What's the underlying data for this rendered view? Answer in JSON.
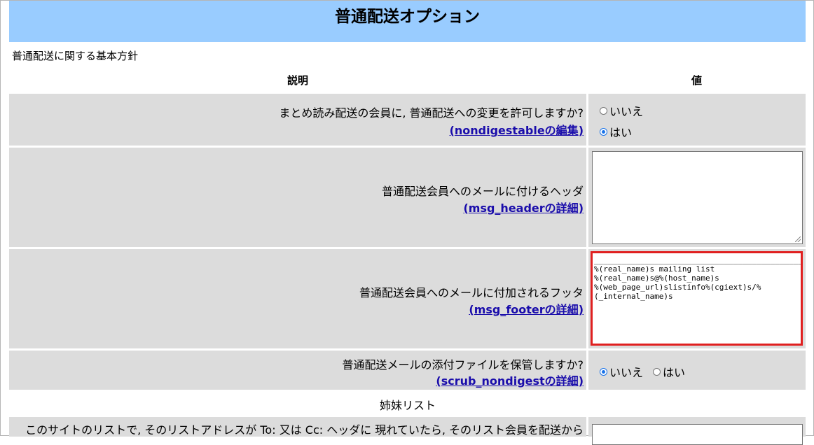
{
  "page": {
    "title": "普通配送オプション",
    "policy_label": "普通配送に関する基本方針"
  },
  "table": {
    "col_desc": "説明",
    "col_value": "値"
  },
  "rows": [
    {
      "question": "まとめ読み配送の会員に, 普通配送への変更を許可しますか?",
      "link_name": "nondigestable",
      "link_suffix": "の編集",
      "options": [
        "いいえ",
        "はい"
      ],
      "selected": "はい"
    },
    {
      "question": "普通配送会員へのメールに付けるヘッダ",
      "link_name": "msg_header",
      "link_suffix": "の詳細",
      "value": ""
    },
    {
      "question": "普通配送会員へのメールに付加されるフッタ",
      "link_name": "msg_footer",
      "link_suffix": "の詳細",
      "value": "_______________________________________________\n%(real_name)s mailing list\n%(real_name)s@%(host_name)s\n%(web_page_url)slistinfo%(cgiext)s/%\n(_internal_name)s"
    },
    {
      "question": "普通配送メールの添付ファイルを保管しますか?",
      "link_name": "scrub_nondigest",
      "link_suffix": "の詳細",
      "options": [
        "いいえ",
        "はい"
      ],
      "selected": "いいえ"
    }
  ],
  "sister": {
    "label": "姉妹リスト",
    "question": "このサイトのリストで, そのリストアドレスが To: 又は Cc: ヘッダに 現れていたら, そのリスト会員を配送から"
  },
  "colors": {
    "title_bg": "#99ccff",
    "row_bg": "#dcdcdc",
    "link": "#1a0dab",
    "highlight": "#e02020"
  }
}
